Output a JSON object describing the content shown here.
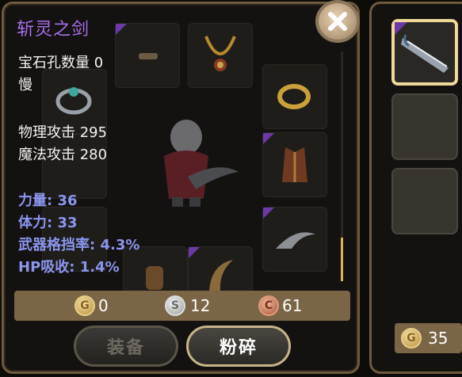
{
  "item": {
    "name": "斩灵之剑",
    "gem_slots": "宝石孔数量 0",
    "speed": "慢",
    "physical_attack": "物理攻击 295",
    "magic_attack": "魔法攻击 280"
  },
  "bonuses": [
    "力量: 36",
    "体力: 33",
    "武器格挡率: 4.3%",
    "HP吸收: 1.4%"
  ],
  "currency": {
    "gold": "0",
    "silver": "12",
    "copper": "61",
    "gold_symbol": "G",
    "silver_symbol": "S",
    "copper_symbol": "C"
  },
  "buttons": {
    "equip": "装备",
    "smash": "粉碎"
  },
  "side": {
    "gold": "35"
  },
  "icons": [
    "close-icon",
    "gold-coin-icon",
    "silver-coin-icon",
    "copper-coin-icon",
    "sword-icon"
  ],
  "colors": {
    "item_name": "#a76ef0",
    "bonus_text": "#8b95ee",
    "rarity": "#6c3aa8",
    "panel_border": "#6e5a3c"
  }
}
